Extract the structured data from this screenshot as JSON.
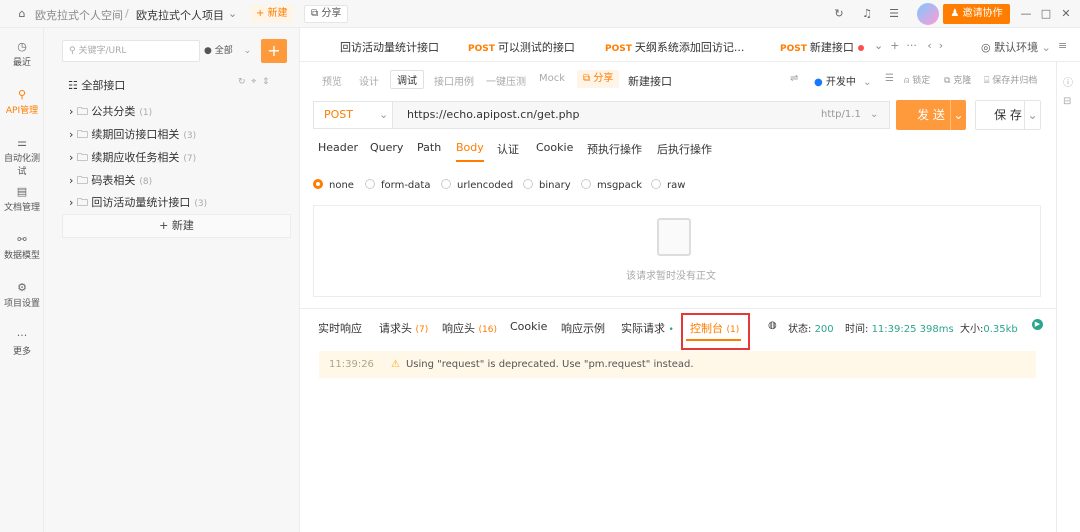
{
  "topbar": {
    "workspace": "欧克拉式个人空间",
    "separator": "/",
    "project": "欧克拉式个人项目",
    "new_label": "+ 新建",
    "share_label": "分享",
    "invite_label": "邀请协作"
  },
  "leftnav": [
    {
      "icon": "◷",
      "label": "最近"
    },
    {
      "icon": "⚲",
      "label": "API管理"
    },
    {
      "icon": "⚌",
      "label": "自动化测试"
    },
    {
      "icon": "▤",
      "label": "文档管理"
    },
    {
      "icon": "⚯",
      "label": "数据模型"
    },
    {
      "icon": "⚙",
      "label": "项目设置"
    },
    {
      "icon": "···",
      "label": "更多"
    }
  ],
  "sidebar": {
    "search_placeholder": "关键字/URL",
    "filter": "全部",
    "add": "+",
    "root": "全部接口",
    "items": [
      {
        "label": "公共分类",
        "count": "(1)"
      },
      {
        "label": "续期回访接口相关",
        "count": "(3)"
      },
      {
        "label": "续期应收任务相关",
        "count": "(7)"
      },
      {
        "label": "码表相关",
        "count": "(8)"
      },
      {
        "label": "回访活动量统计接口",
        "count": "(3)"
      }
    ],
    "new_label": "+ 新建"
  },
  "tabs": [
    {
      "method": "",
      "label": "回访活动量统计接口"
    },
    {
      "method": "POST",
      "label": "可以测试的接口"
    },
    {
      "method": "POST",
      "label": "天纲系统添加回访记..."
    },
    {
      "method": "POST",
      "label": "新建接口"
    }
  ],
  "env_label": "默认环境",
  "subtabs": [
    "预览",
    "设计",
    "调试",
    "接口用例",
    "一键压测",
    "Mock"
  ],
  "share2": "分享",
  "api_name": "新建接口",
  "dev_status": "开发中",
  "tools": [
    "锁定",
    "克隆",
    "保存并归档"
  ],
  "request": {
    "method": "POST",
    "url": "https://echo.apipost.cn/get.php",
    "http_version": "http/1.1",
    "send": "发 送",
    "save": "保 存"
  },
  "reqtabs": [
    "Header",
    "Query",
    "Path",
    "Body",
    "认证",
    "Cookie",
    "预执行操作",
    "后执行操作"
  ],
  "body_types": [
    "none",
    "form-data",
    "urlencoded",
    "binary",
    "msgpack",
    "raw"
  ],
  "empty_text": "该请求暂时没有正文",
  "resptabs": [
    {
      "label": "实时响应",
      "count": ""
    },
    {
      "label": "请求头",
      "count": "(7)"
    },
    {
      "label": "响应头",
      "count": "(16)"
    },
    {
      "label": "Cookie",
      "count": ""
    },
    {
      "label": "响应示例",
      "count": ""
    },
    {
      "label": "实际请求",
      "count": "•"
    },
    {
      "label": "控制台",
      "count": "(1)"
    }
  ],
  "status": {
    "status_label": "状态:",
    "status_value": "200",
    "time_label": "时间:",
    "time_value": "11:39:25 398ms",
    "size_label": "大小:",
    "size_value": "0.35kb"
  },
  "console": {
    "time": "11:39:26",
    "message": "Using \"request\" is deprecated. Use \"pm.request\" instead."
  }
}
